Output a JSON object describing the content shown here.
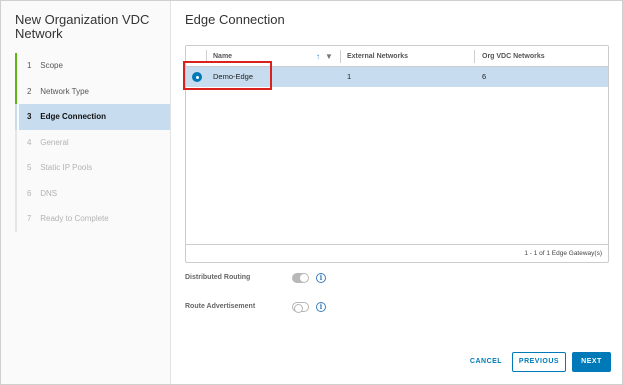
{
  "wizard": {
    "title": "New Organization VDC Network",
    "steps": [
      {
        "num": "1",
        "label": "Scope",
        "state": "done"
      },
      {
        "num": "2",
        "label": "Network Type",
        "state": "done"
      },
      {
        "num": "3",
        "label": "Edge Connection",
        "state": "current"
      },
      {
        "num": "4",
        "label": "General",
        "state": "pending"
      },
      {
        "num": "5",
        "label": "Static IP Pools",
        "state": "pending"
      },
      {
        "num": "6",
        "label": "DNS",
        "state": "pending"
      },
      {
        "num": "7",
        "label": "Ready to Complete",
        "state": "pending"
      }
    ]
  },
  "page": {
    "title": "Edge Connection"
  },
  "grid": {
    "columns": [
      "Name",
      "External Networks",
      "Org VDC Networks"
    ],
    "rows": [
      {
        "name": "Demo-Edge",
        "external_networks": "1",
        "org_vdc_networks": "6",
        "selected": true
      }
    ],
    "footer": "1 - 1 of 1 Edge Gateway(s)",
    "sort_icon": "sort-up-icon",
    "filter_icon": "filter-icon"
  },
  "options": {
    "distributed_routing": {
      "label": "Distributed Routing",
      "enabled": true
    },
    "route_advertisement": {
      "label": "Route Advertisement",
      "enabled": false
    }
  },
  "buttons": {
    "cancel": "CANCEL",
    "previous": "PREVIOUS",
    "next": "NEXT"
  },
  "colors": {
    "accent": "#0079b8",
    "selected_row": "#c7dcee",
    "done_step": "#60b515",
    "highlight": "#d9221c"
  }
}
